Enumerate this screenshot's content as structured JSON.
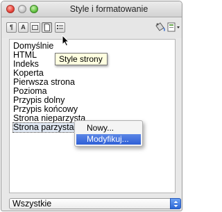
{
  "window": {
    "title": "Style i formatowanie"
  },
  "toolbar": {
    "buttons": [
      {
        "name": "paragraph-styles",
        "glyph": "¶"
      },
      {
        "name": "character-styles",
        "glyph": "A"
      },
      {
        "name": "frame-styles",
        "glyph": ""
      },
      {
        "name": "page-styles",
        "glyph": "",
        "pressed": true
      },
      {
        "name": "list-styles",
        "glyph": ""
      }
    ],
    "fill_format_icon": "fill-format-icon",
    "new_style_icon": "new-style-icon"
  },
  "tooltip": {
    "text": "Style strony"
  },
  "list": {
    "items": [
      "Domyślnie",
      "HTML",
      "Indeks",
      "Koperta",
      "Pierwsza strona",
      "Pozioma",
      "Przypis dolny",
      "Przypis końcowy",
      "Strona nieparzysta",
      "Strona parzysta"
    ],
    "selected": "Strona parzysta"
  },
  "context_menu": {
    "items": [
      "Nowy...",
      "Modyfikuj..."
    ],
    "highlighted": "Modyfikuj..."
  },
  "filter": {
    "value": "Wszystkie"
  }
}
